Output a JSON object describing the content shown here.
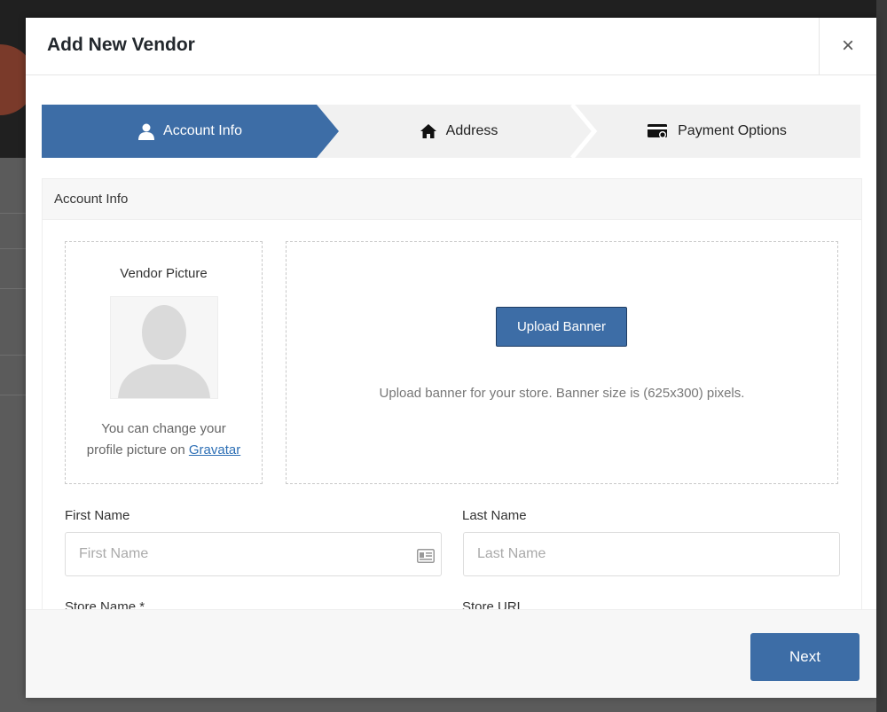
{
  "modal": {
    "title": "Add New Vendor",
    "close_label": "×"
  },
  "steps": [
    {
      "label": "Account Info",
      "icon": "user-icon",
      "active": true
    },
    {
      "label": "Address",
      "icon": "home-icon",
      "active": false
    },
    {
      "label": "Payment Options",
      "icon": "payment-card-icon",
      "active": false
    }
  ],
  "panel": {
    "title": "Account Info"
  },
  "vendor_picture": {
    "label": "Vendor Picture",
    "note_line1": "You can change your",
    "note_line2_prefix": "profile picture on ",
    "gravatar_link": "Gravatar"
  },
  "banner": {
    "button": "Upload Banner",
    "note": "Upload banner for your store. Banner size is (625x300) pixels."
  },
  "fields": {
    "first_name": {
      "label": "First Name",
      "placeholder": "First Name",
      "value": ""
    },
    "last_name": {
      "label": "Last Name",
      "placeholder": "Last Name",
      "value": ""
    },
    "store_name": {
      "label": "Store Name *"
    },
    "store_url": {
      "label": "Store URL"
    }
  },
  "footer": {
    "next": "Next"
  },
  "colors": {
    "accent": "#3d6da6",
    "link": "#2d6fb5"
  }
}
